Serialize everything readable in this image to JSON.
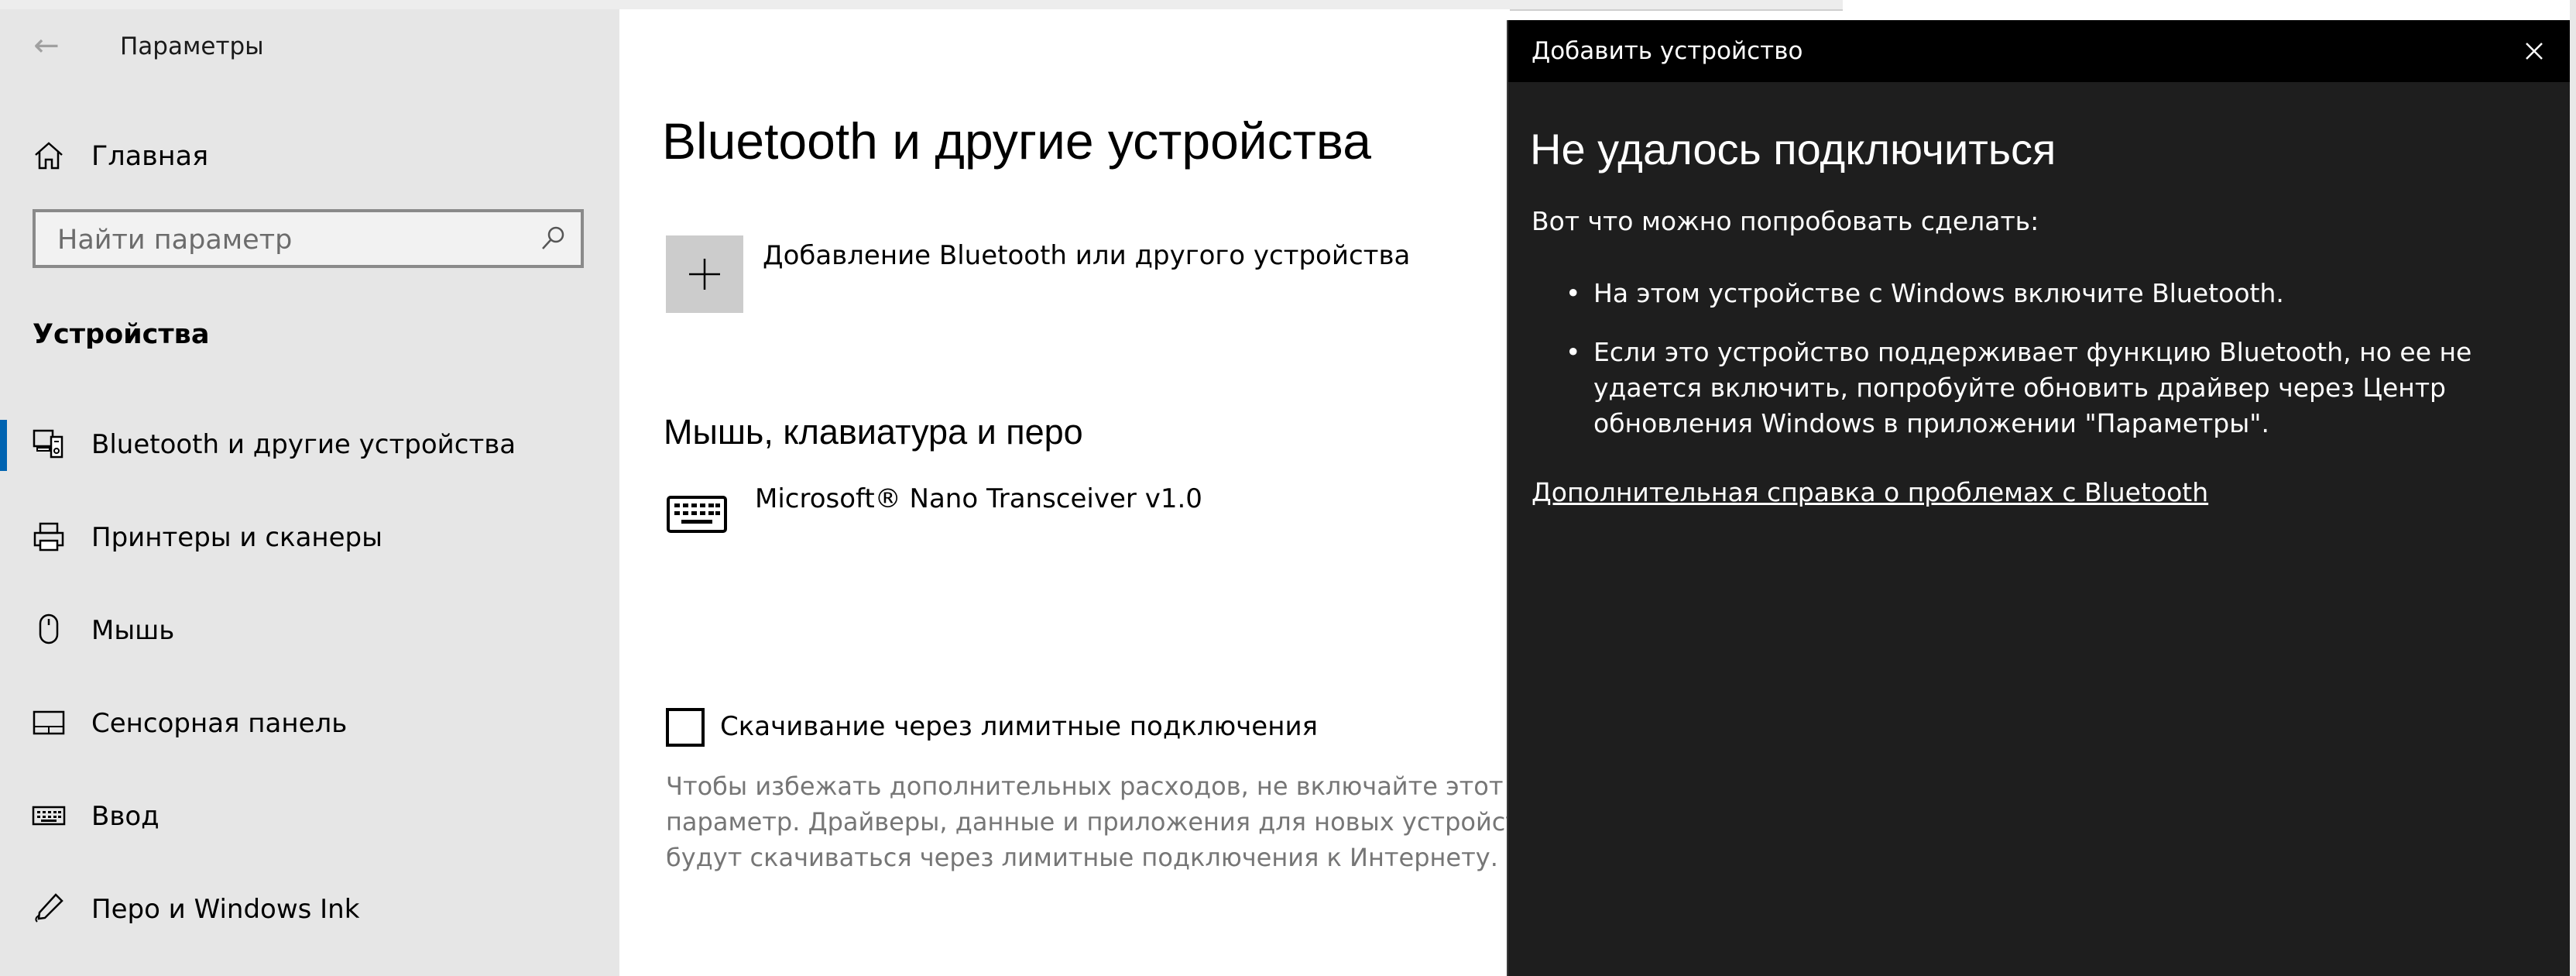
{
  "settings": {
    "app_title": "Параметры",
    "back_label": "←",
    "home_label": "Главная",
    "search_placeholder": "Найти параметр",
    "section_title": "Устройства",
    "nav": [
      {
        "label": "Bluetooth и другие устройства",
        "icon": "bluetooth-devices-icon",
        "active": true
      },
      {
        "label": "Принтеры и сканеры",
        "icon": "printer-icon"
      },
      {
        "label": "Мышь",
        "icon": "mouse-icon"
      },
      {
        "label": "Сенсорная панель",
        "icon": "touchpad-icon"
      },
      {
        "label": "Ввод",
        "icon": "keyboard-icon"
      },
      {
        "label": "Перо и Windows Ink",
        "icon": "pen-icon"
      }
    ]
  },
  "main": {
    "page_title": "Bluetooth и другие устройства",
    "add_device_label": "Добавление Bluetooth или другого устройства",
    "add_icon": "plus-icon",
    "subsection_title": "Мышь, клавиатура и перо",
    "device_name": "Microsoft® Nano Transceiver v1.0",
    "device_icon": "keyboard-icon",
    "metered_label": "Скачивание через лимитные подключения",
    "metered_checked": false,
    "metered_desc": [
      "Чтобы избежать дополнительных расходов, не включайте этот",
      "параметр. Драйверы, данные и приложения для новых устройств н",
      "будут скачиваться через лимитные подключения к Интернету."
    ]
  },
  "dialog": {
    "title": "Добавить устройство",
    "close_icon": "close-icon",
    "heading": "Не удалось подключиться",
    "intro": "Вот что можно попробовать сделать:",
    "bullet_1": "На этом устройстве с Windows включите Bluetooth.",
    "bullet_2": [
      "Если это устройство поддерживает функцию Bluetooth, но ее не",
      "удается включить, попробуйте обновить драйвер через Центр",
      "обновления Windows в приложении \"Параметры\"."
    ],
    "bullet_symbol": "•",
    "help_link": "Дополнительная справка о проблемах с Bluetooth"
  },
  "colors": {
    "sidebar_bg": "#e6e6e6",
    "accent": "#0063b1",
    "dialog_bg": "#1e1e1e",
    "dialog_header_bg": "#000000"
  }
}
